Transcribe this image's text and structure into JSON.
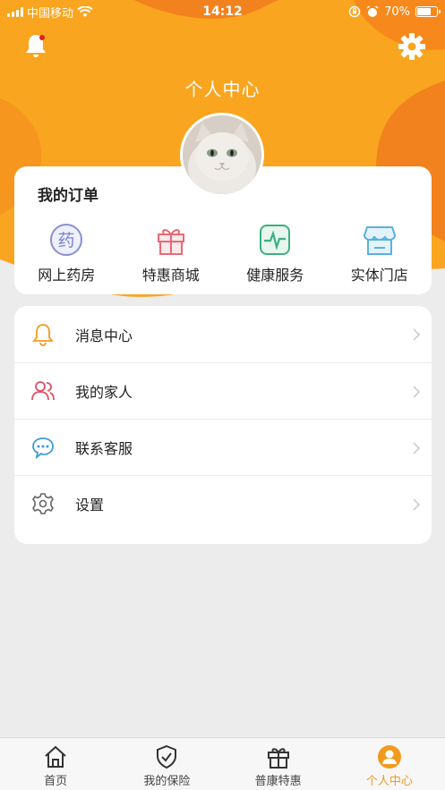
{
  "status_bar": {
    "carrier": "中国移动",
    "time": "14:12",
    "battery": "70%",
    "battery_level": 0.7
  },
  "header": {
    "title": "个人中心"
  },
  "orders": {
    "title": "我的订单",
    "items": [
      {
        "label": "网上药房",
        "icon": "pharmacy-icon",
        "glyph": "药"
      },
      {
        "label": "特惠商城",
        "icon": "gift-icon"
      },
      {
        "label": "健康服务",
        "icon": "health-monitor-icon"
      },
      {
        "label": "实体门店",
        "icon": "store-icon"
      }
    ]
  },
  "menu": {
    "items": [
      {
        "label": "消息中心",
        "icon": "bell-icon"
      },
      {
        "label": "我的家人",
        "icon": "family-icon"
      },
      {
        "label": "联系客服",
        "icon": "chat-icon"
      },
      {
        "label": "设置",
        "icon": "gear-icon"
      }
    ]
  },
  "tabs": [
    {
      "label": "首页",
      "icon": "home-icon",
      "active": false
    },
    {
      "label": "我的保险",
      "icon": "shield-check-icon",
      "active": false
    },
    {
      "label": "普康特惠",
      "icon": "gift-icon",
      "active": false
    },
    {
      "label": "个人中心",
      "icon": "user-icon",
      "active": true
    }
  ],
  "colors": {
    "accent": "#f29a1d",
    "header_orange": "#f9a51f",
    "header_deep": "#f2821e"
  }
}
